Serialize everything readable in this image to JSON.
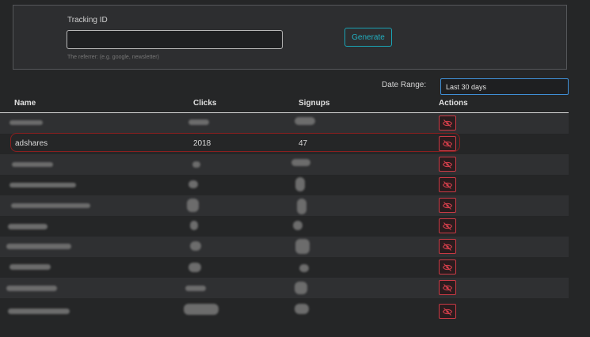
{
  "form": {
    "tracking_label": "Tracking ID",
    "tracking_value": "",
    "tracking_placeholder": "",
    "help_text": "The referrer: (e.g. google, newsletter)",
    "generate_label": "Generate"
  },
  "filters": {
    "date_label": "Date Range:",
    "date_selected": "Last 30 days"
  },
  "table": {
    "headers": {
      "name": "Name",
      "clicks": "Clicks",
      "signups": "Signups",
      "actions": "Actions"
    },
    "visible_row": {
      "name": "adshares",
      "clicks": "2018",
      "signups": "47"
    }
  },
  "icons": {
    "action": "eye-off-icon"
  },
  "colors": {
    "accent_teal": "#1aa3b4",
    "danger_red": "#c93a45",
    "focus_blue": "#3f8fd6"
  }
}
